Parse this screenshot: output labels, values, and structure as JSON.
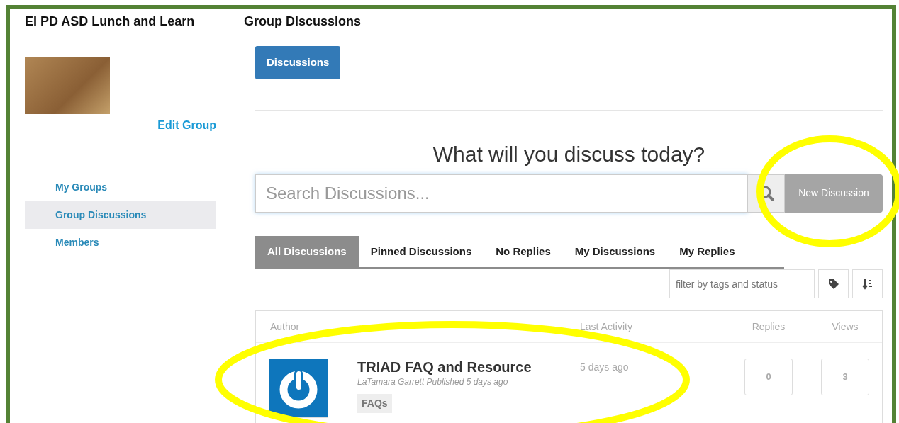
{
  "sidebar": {
    "group_title": "EI PD ASD Lunch and Learn",
    "edit_link": "Edit Group",
    "items": [
      {
        "label": "My Groups",
        "selected": false
      },
      {
        "label": "Group Discussions",
        "selected": true
      },
      {
        "label": "Members",
        "selected": false
      }
    ]
  },
  "main": {
    "page_title": "Group Discussions",
    "discussions_button": "Discussions",
    "heading": "What will you discuss today?",
    "search": {
      "placeholder": "Search Discussions..."
    },
    "new_discussion_button": "New Discussion",
    "tabs": [
      {
        "label": "All Discussions",
        "selected": true
      },
      {
        "label": "Pinned Discussions",
        "selected": false
      },
      {
        "label": "No Replies",
        "selected": false
      },
      {
        "label": "My Discussions",
        "selected": false
      },
      {
        "label": "My Replies",
        "selected": false
      }
    ],
    "filter": {
      "placeholder": "filter by tags and status"
    },
    "table": {
      "columns": [
        "Author",
        "",
        "Last Activity",
        "Replies",
        "Views"
      ],
      "rows": [
        {
          "title": "TRIAD FAQ and Resource",
          "byline": "LaTamara Garrett Published 5 days ago",
          "tags": [
            "FAQs"
          ],
          "last_activity": "5 days ago",
          "replies": "0",
          "views": "3"
        }
      ]
    }
  },
  "highlights": [
    {
      "kind": "ellipse"
    },
    {
      "kind": "ellipse"
    }
  ]
}
